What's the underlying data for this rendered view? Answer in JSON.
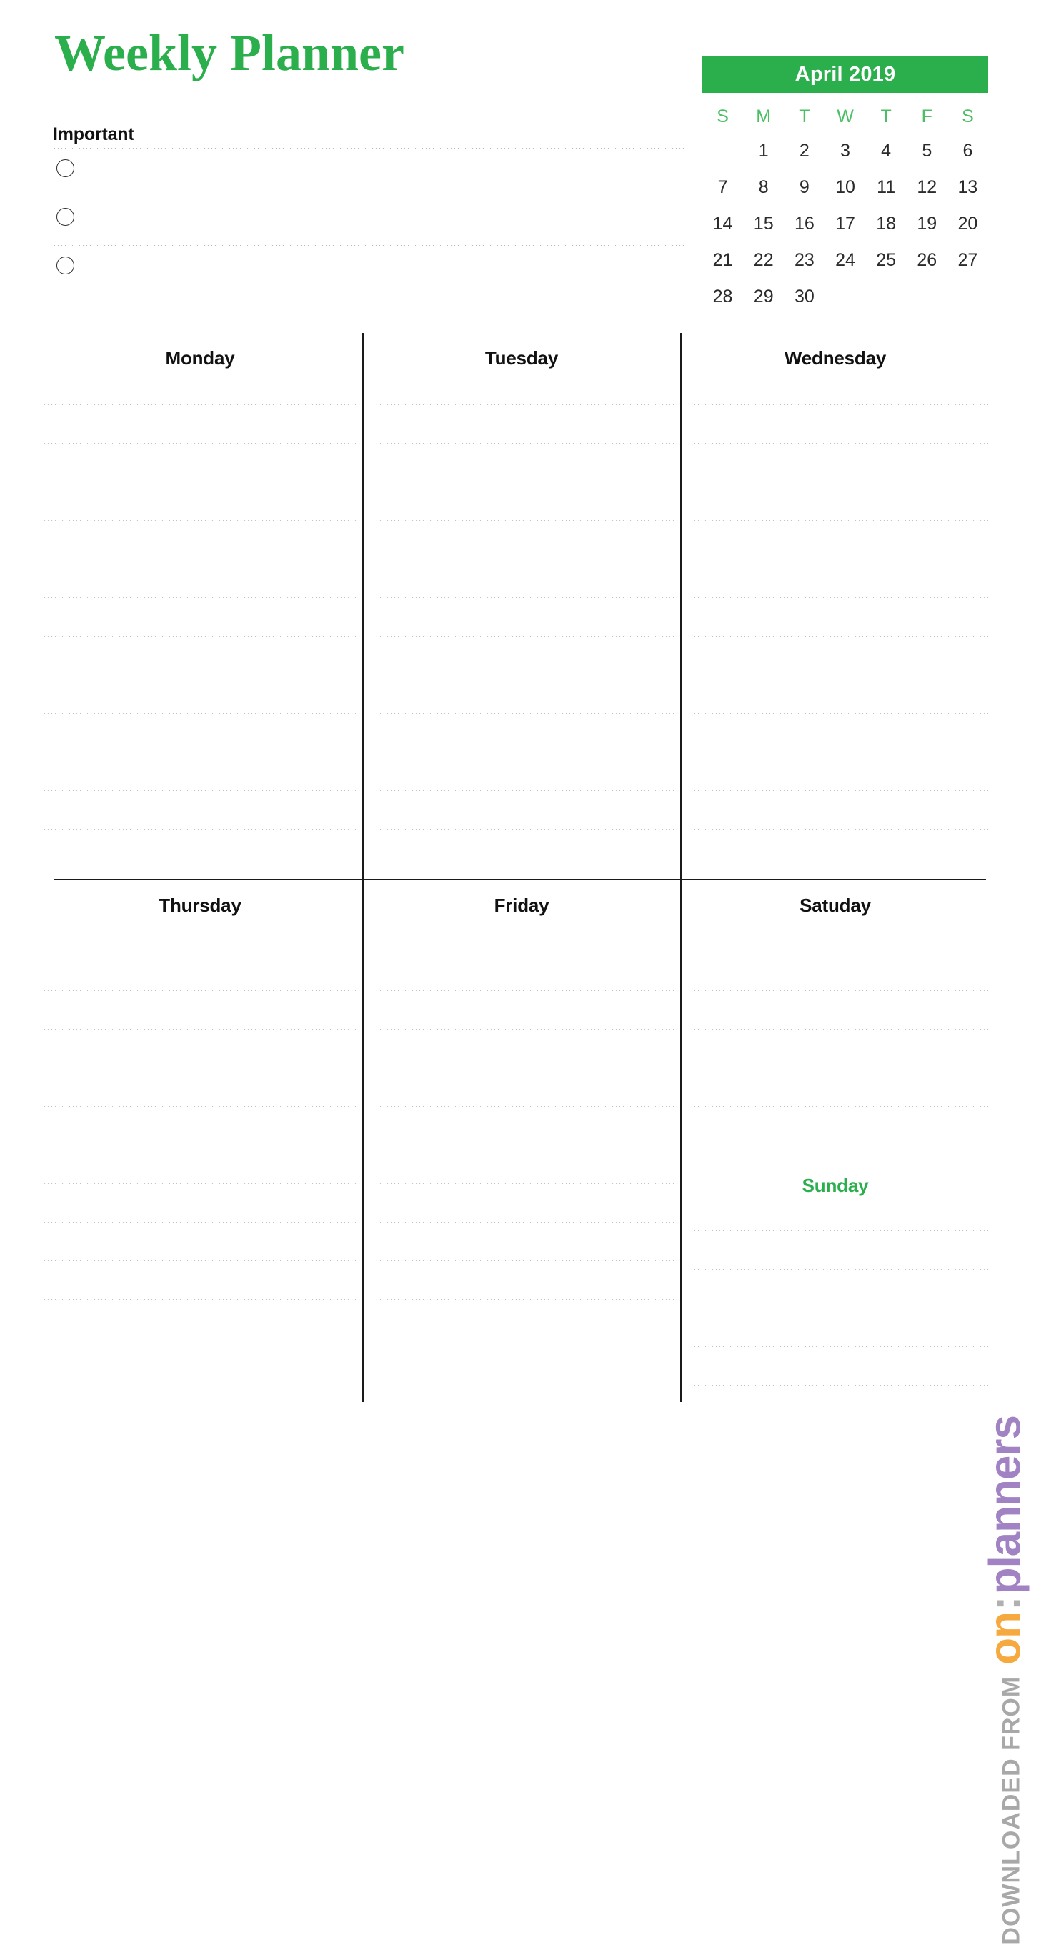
{
  "page": {
    "title": "Weekly Planner",
    "accent_green": "#2bae4c",
    "dow_green": "#4cbf64",
    "ink": "#1a1a1a"
  },
  "important": {
    "heading": "Important",
    "rows": 3
  },
  "calendar": {
    "month_label": "April 2019",
    "weekday_headers": [
      "S",
      "M",
      "T",
      "W",
      "T",
      "F",
      "S"
    ],
    "weeks": [
      [
        "",
        "1",
        "2",
        "3",
        "4",
        "5",
        "6"
      ],
      [
        "7",
        "8",
        "9",
        "10",
        "11",
        "12",
        "13"
      ],
      [
        "14",
        "15",
        "16",
        "17",
        "18",
        "19",
        "20"
      ],
      [
        "21",
        "22",
        "23",
        "24",
        "25",
        "26",
        "27"
      ],
      [
        "28",
        "29",
        "30",
        "",
        "",
        "",
        ""
      ]
    ]
  },
  "week": {
    "monday": "Monday",
    "tuesday": "Tuesday",
    "wednesday": "Wednesday",
    "thursday": "Thursday",
    "friday": "Friday",
    "saturday": "Satuday",
    "sunday": "Sunday"
  },
  "watermark": {
    "from_text": "DOWNLOADED FROM",
    "brand_on": "on",
    "brand_colon": ":",
    "brand_planners": "planners",
    "color_from": "#a8a8a8",
    "color_on": "#f5a93f",
    "color_planners": "#a183c4"
  }
}
